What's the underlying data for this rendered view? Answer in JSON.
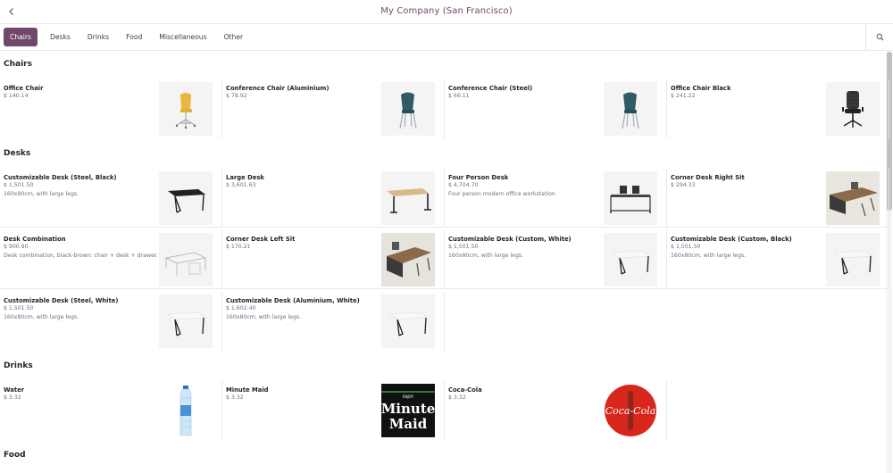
{
  "header": {
    "title": "My Company (San Francisco)"
  },
  "tabs": [
    "Chairs",
    "Desks",
    "Drinks",
    "Food",
    "Miscellaneous",
    "Other"
  ],
  "categories": [
    {
      "name": "Chairs",
      "products": [
        {
          "name": "Office Chair",
          "price": "$ 140.14",
          "icon": "office-chair-yellow"
        },
        {
          "name": "Conference Chair (Aluminium)",
          "price": "$ 78.92",
          "icon": "conference-chair-teal"
        },
        {
          "name": "Conference Chair (Steel)",
          "price": "$ 66.11",
          "icon": "conference-chair-teal"
        },
        {
          "name": "Office Chair Black",
          "price": "$ 241.22",
          "icon": "office-chair-black"
        }
      ]
    },
    {
      "name": "Desks",
      "products": [
        {
          "name": "Customizable Desk (Steel, Black)",
          "price": "$ 1,501.50",
          "desc": "160x80cm, with large legs.",
          "icon": "desk-black"
        },
        {
          "name": "Large Desk",
          "price": "$ 3,601.63",
          "icon": "desk-wood"
        },
        {
          "name": "Four Person Desk",
          "price": "$ 4,704.70",
          "desc": "Four person modern office workstation",
          "icon": "four-person-desk"
        },
        {
          "name": "Corner Desk Right Sit",
          "price": "$ 294.33",
          "icon": "corner-desk"
        },
        {
          "name": "Desk Combination",
          "price": "$ 900.90",
          "desc": "Desk combination, black-brown: chair + desk + drawer.",
          "icon": "desk-combination"
        },
        {
          "name": "Corner Desk Left Sit",
          "price": "$ 170.21",
          "icon": "corner-desk"
        },
        {
          "name": "Customizable Desk (Custom, White)",
          "price": "$ 1,501.50",
          "desc": "160x80cm, with large legs.",
          "icon": "desk-white"
        },
        {
          "name": "Customizable Desk (Custom, Black)",
          "price": "$ 1,501.50",
          "desc": "160x80cm, with large legs.",
          "icon": "desk-white"
        },
        {
          "name": "Customizable Desk (Steel, White)",
          "price": "$ 1,501.50",
          "desc": "160x80cm, with large legs.",
          "icon": "desk-white"
        },
        {
          "name": "Customizable Desk (Aluminium, White)",
          "price": "$ 1,602.40",
          "desc": "160x80cm, with large legs.",
          "icon": "desk-white"
        }
      ]
    },
    {
      "name": "Drinks",
      "products": [
        {
          "name": "Water",
          "price": "$ 3.32",
          "icon": "water-bottle"
        },
        {
          "name": "Minute Maid",
          "price": "$ 3.32",
          "icon": "minute-maid-logo",
          "logo_text": [
            "ENJOY",
            "Minute",
            "Maid"
          ]
        },
        {
          "name": "Coca-Cola",
          "price": "$ 3.32",
          "icon": "coca-cola-logo",
          "logo_text": "Coca-Cola"
        }
      ]
    },
    {
      "name": "Food",
      "products": []
    }
  ],
  "colors": {
    "brand": "#71486b",
    "border": "#e7e9ed",
    "text_muted": "#6b7280",
    "image_bg": "#f4f4f4"
  }
}
